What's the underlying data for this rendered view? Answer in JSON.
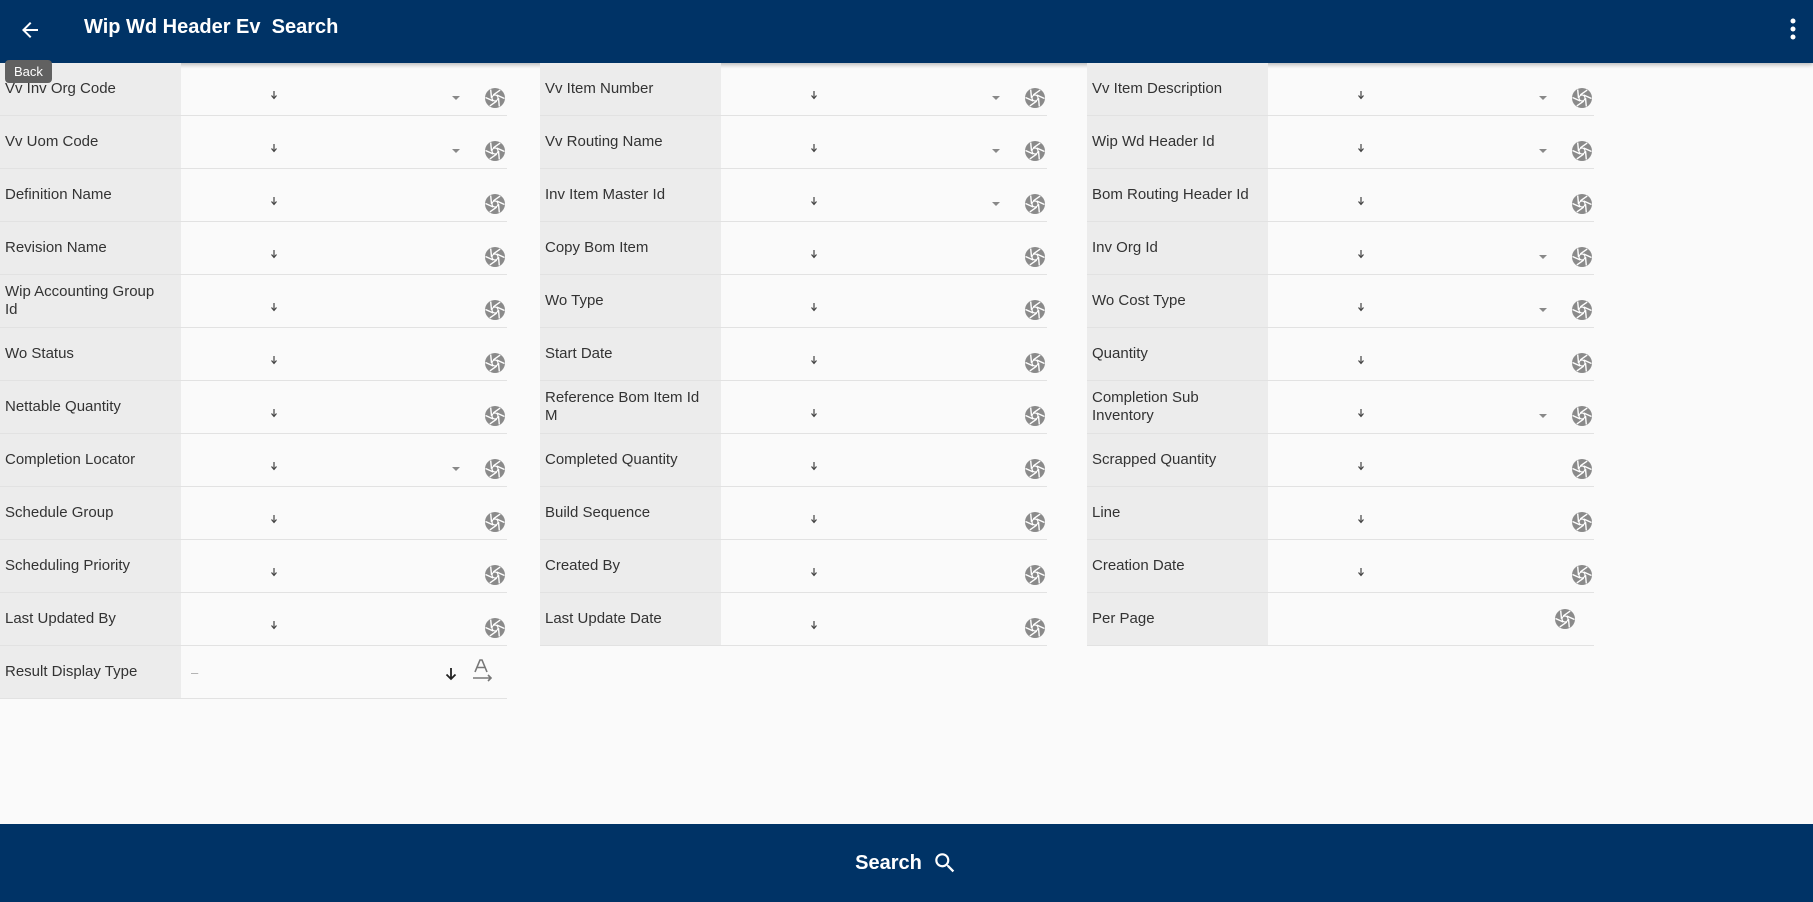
{
  "header": {
    "title": "Wip Wd Header Ev  Search",
    "back_tooltip": "Back"
  },
  "fields": {
    "col1": [
      {
        "label": "Vv Inv Org Code",
        "dropdown": true
      },
      {
        "label": "Vv Uom Code",
        "dropdown": true
      },
      {
        "label": "Definition Name",
        "dropdown": false
      },
      {
        "label": "Revision Name",
        "dropdown": false
      },
      {
        "label": "Wip Accounting Group Id",
        "dropdown": false
      },
      {
        "label": "Wo Status",
        "dropdown": false
      },
      {
        "label": "Nettable Quantity",
        "dropdown": false
      },
      {
        "label": "Completion Locator",
        "dropdown": true
      },
      {
        "label": "Schedule Group",
        "dropdown": false
      },
      {
        "label": "Scheduling Priority",
        "dropdown": false
      },
      {
        "label": "Last Updated By",
        "dropdown": false
      }
    ],
    "col2": [
      {
        "label": "Vv Item Number",
        "dropdown": true
      },
      {
        "label": "Vv Routing Name",
        "dropdown": true
      },
      {
        "label": "Inv Item Master Id",
        "dropdown": true
      },
      {
        "label": "Copy Bom Item",
        "dropdown": false
      },
      {
        "label": "Wo Type",
        "dropdown": false
      },
      {
        "label": "Start Date",
        "dropdown": false
      },
      {
        "label": "Reference Bom Item Id M",
        "dropdown": false
      },
      {
        "label": "Completed Quantity",
        "dropdown": false
      },
      {
        "label": "Build Sequence",
        "dropdown": false
      },
      {
        "label": "Created By",
        "dropdown": false
      },
      {
        "label": "Last Update Date",
        "dropdown": false
      }
    ],
    "col3": [
      {
        "label": "Vv Item Description",
        "dropdown": true
      },
      {
        "label": "Wip Wd Header Id",
        "dropdown": true
      },
      {
        "label": "Bom Routing Header Id",
        "dropdown": false
      },
      {
        "label": "Inv Org Id",
        "dropdown": true
      },
      {
        "label": "Wo Cost Type",
        "dropdown": true
      },
      {
        "label": "Quantity",
        "dropdown": false
      },
      {
        "label": "Completion Sub Inventory",
        "dropdown": true
      },
      {
        "label": "Scrapped Quantity",
        "dropdown": false
      },
      {
        "label": "Line",
        "dropdown": false
      },
      {
        "label": "Creation Date",
        "dropdown": false
      }
    ]
  },
  "per_page": {
    "label": "Per Page"
  },
  "result_display": {
    "label": "Result Display Type",
    "value": "–"
  },
  "footer": {
    "search_label": "Search"
  },
  "colors": {
    "primary": "#003366",
    "label_bg": "#ececec",
    "icon": "#8a8a8a"
  }
}
